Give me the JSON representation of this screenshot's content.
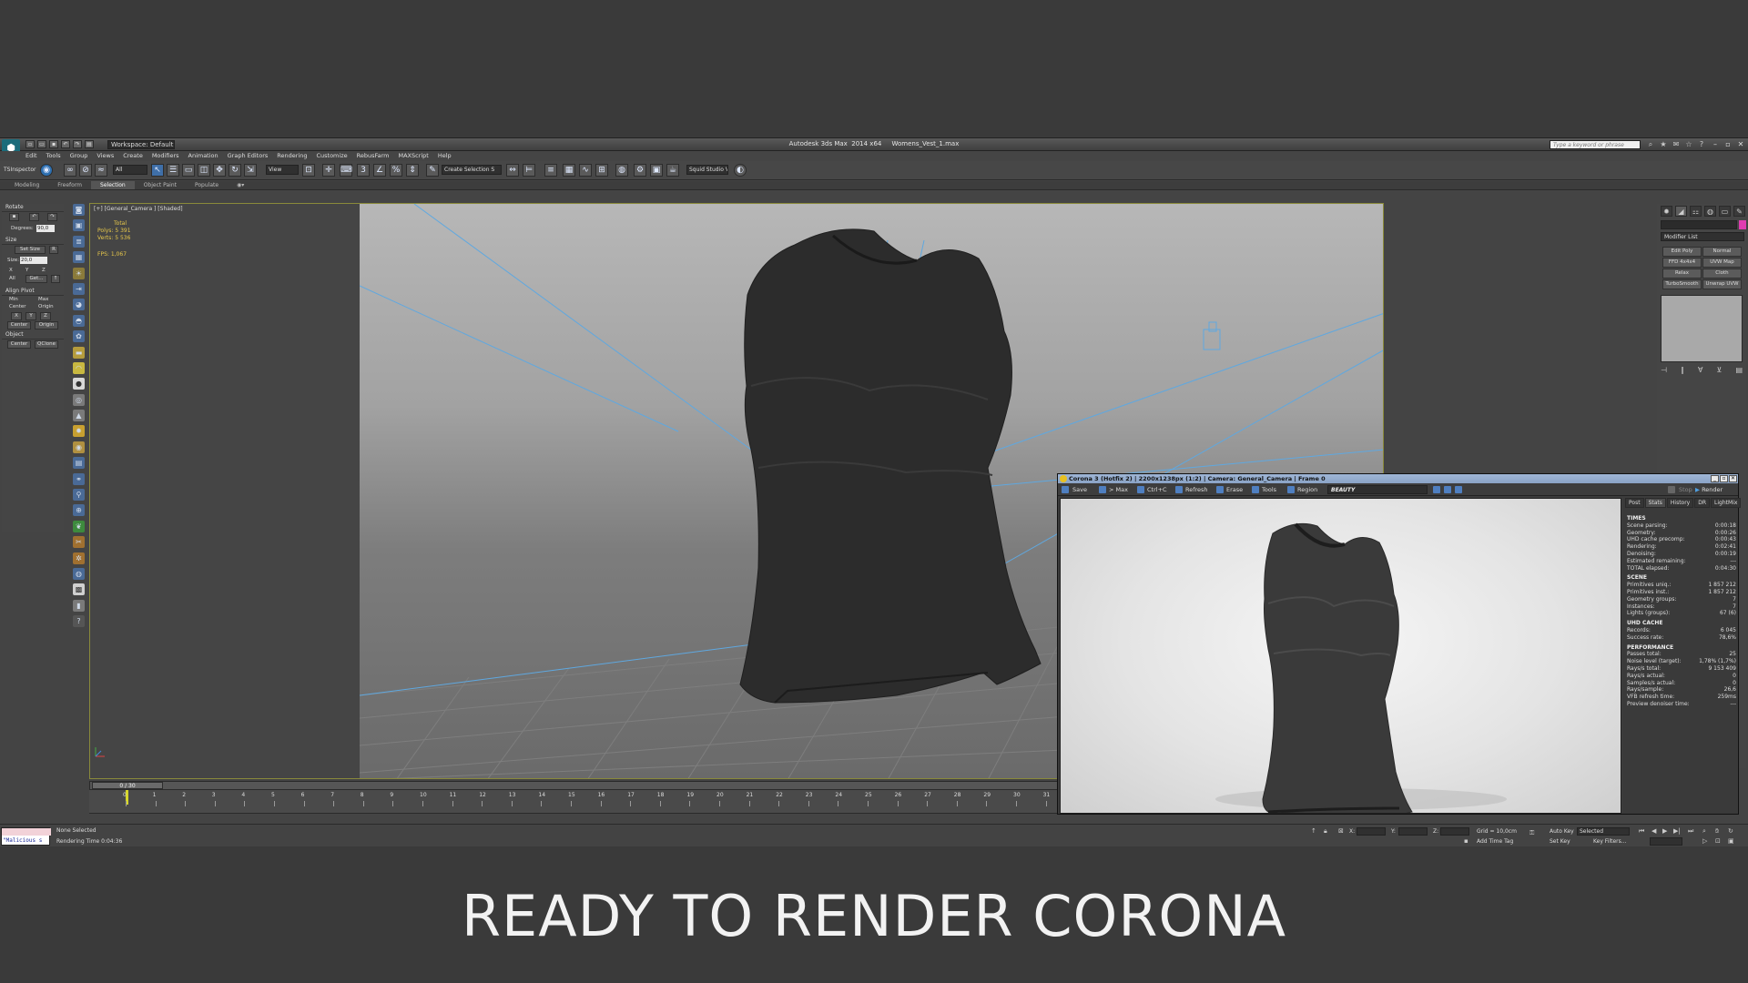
{
  "window": {
    "app_title": "Autodesk 3ds Max  2014 x64     Womens_Vest_1.max",
    "workspace": "Workspace: Default",
    "search_placeholder": "Type a keyword or phrase"
  },
  "menu": [
    "Edit",
    "Tools",
    "Group",
    "Views",
    "Create",
    "Modifiers",
    "Animation",
    "Graph Editors",
    "Rendering",
    "Customize",
    "RebusFarm",
    "MAXScript",
    "Help"
  ],
  "toolbar": {
    "tsinspector": "TSInspector",
    "filter": "All",
    "refcoord": "View",
    "named_selection": "Create Selection S",
    "squid": "Squid Studio V"
  },
  "ribbon_tabs": [
    "Modeling",
    "Freeform",
    "Selection",
    "Object Paint",
    "Populate"
  ],
  "left_panel": {
    "rotate_title": "Rotate",
    "degrees_label": "Degrees:",
    "degrees_value": "90,0",
    "size_title": "Size",
    "set_size": "Set Size",
    "size_r": "R",
    "size_label": "Size:",
    "size_value": "20,0",
    "axis_x": "X",
    "axis_y": "Y",
    "axis_z": "Z",
    "all_label": "All",
    "get_label": "Get...",
    "align_title": "Align Pivot",
    "min": "Min",
    "max": "Max",
    "center": "Center",
    "origin": "Origin",
    "center_btn": "Center",
    "origin_btn": "Origin",
    "object_title": "Object",
    "object_center": "Center",
    "qclone": "QClone"
  },
  "viewport": {
    "label": "[+] [General_Camera ] [Shaded]",
    "stats": {
      "total": "Total",
      "polys_label": "Polys:",
      "polys": "5 391",
      "verts_label": "Verts:",
      "verts": "5 536",
      "fps_label": "FPS:",
      "fps": "1,067"
    }
  },
  "right_panel": {
    "modifier_list": "Modifier List",
    "buttons": [
      "Edit Poly",
      "Normal",
      "FFD 4x4x4",
      "UVW Map",
      "Relax",
      "Cloth",
      "TurboSmooth",
      "Unwrap UVW"
    ]
  },
  "timeline": {
    "slider": "0 / 30",
    "ticks": [
      "0",
      "1",
      "2",
      "3",
      "4",
      "5",
      "6",
      "7",
      "8",
      "9",
      "10",
      "11",
      "12",
      "13",
      "14",
      "15",
      "16",
      "17",
      "18",
      "19",
      "20",
      "21",
      "22",
      "23",
      "24",
      "25",
      "26",
      "27",
      "28",
      "29",
      "30",
      "31"
    ]
  },
  "status": {
    "maxscript": "\"Malicious s",
    "selection": "None Selected",
    "render_time": "Rendering Time  0:04:36",
    "x_label": "X:",
    "y_label": "Y:",
    "z_label": "Z:",
    "grid": "Grid = 10,0cm",
    "add_time_tag": "Add Time Tag",
    "auto_key": "Auto Key",
    "selected": "Selected",
    "set_key": "Set Key",
    "key_filters": "Key Filters..."
  },
  "vfb": {
    "title": "Corona 3 (Hotfix 2) | 2200x1238px (1:2) | Camera: General_Camera | Frame 0",
    "toolbar": {
      "save": "Save",
      "to_max": "> Max",
      "ctrl_c": "Ctrl+C",
      "refresh": "Refresh",
      "erase": "Erase",
      "tools": "Tools",
      "region": "Region",
      "channel": "BEAUTY",
      "stop": "Stop",
      "render": "Render"
    },
    "tabs": [
      "Post",
      "Stats",
      "History",
      "DR",
      "LightMix"
    ],
    "stats": [
      {
        "head": "TIMES",
        "rows": [
          [
            "Scene parsing:",
            "0:00:18"
          ],
          [
            "Geometry:",
            "0:00:26"
          ],
          [
            "UHD cache precomp:",
            "0:00:43"
          ],
          [
            "Rendering:",
            "0:02:41"
          ],
          [
            "Denoising:",
            "0:00:19"
          ],
          [
            "Estimated remaining:",
            "---"
          ],
          [
            "TOTAL elapsed:",
            "0:04:30"
          ]
        ]
      },
      {
        "head": "SCENE",
        "rows": [
          [
            "Primitives uniq.:",
            "1 857 212"
          ],
          [
            "Primitives inst.:",
            "1 857 212"
          ],
          [
            "Geometry groups:",
            "7"
          ],
          [
            "Instances:",
            "7"
          ],
          [
            "Lights (groups):",
            "67 (6)"
          ]
        ]
      },
      {
        "head": "UHD CACHE",
        "rows": [
          [
            "Records:",
            "6 045"
          ],
          [
            "Success rate:",
            "78,6%"
          ]
        ]
      },
      {
        "head": "PERFORMANCE",
        "rows": [
          [
            "Passes total:",
            "25"
          ],
          [
            "Noise level (target):",
            "1,78% (1,7%)"
          ],
          [
            "Rays/s total:",
            "9 153 409"
          ],
          [
            "Rays/s actual:",
            "0"
          ],
          [
            "Samples/s actual:",
            "0"
          ],
          [
            "Rays/sample:",
            "26,6"
          ],
          [
            "VFB refresh time:",
            "259ms"
          ],
          [
            "Preview denoiser time:",
            "---"
          ]
        ]
      }
    ]
  },
  "caption": "READY TO RENDER  CORONA"
}
